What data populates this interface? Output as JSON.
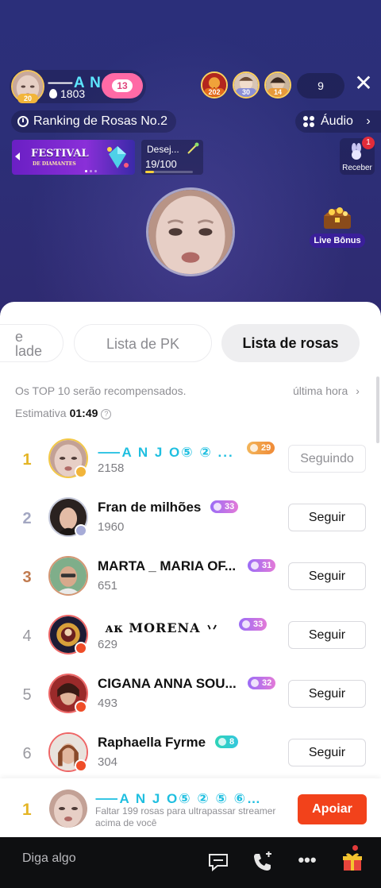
{
  "room": {
    "host_name_prefix": "⸺",
    "host_name_accent": "A N",
    "host_name_suffix": "...",
    "host_level": "20",
    "host_score": "1803",
    "follow_count": "13",
    "viewers": [
      {
        "level": "202",
        "color": "#e36a1c"
      },
      {
        "level": "30",
        "color": "#8a8fd6"
      },
      {
        "level": "14",
        "color": "#e89a3a"
      }
    ],
    "viewer_count": "9",
    "close_icon": "close-icon",
    "ranking_label": "Ranking de Rosas No.2",
    "audio_label": "Áudio",
    "festival_title": "FESTIVAL",
    "festival_subtitle": "DE DIAMANTES",
    "wish_label": "Desej...",
    "wish_progress": "19/100",
    "wish_fraction": 0.19,
    "receive_label": "Receber",
    "receive_badge": "1",
    "live_bonus_label": "Live Bônus"
  },
  "sheet": {
    "tabs": [
      {
        "label": "e\nlade"
      },
      {
        "label": "Lista de PK"
      },
      {
        "label": "Lista de rosas"
      }
    ],
    "note": "Os TOP 10 serão recompensados.",
    "last_hour": "última hora",
    "estimate_label": "Estimativa",
    "estimate_time": "01:49",
    "rows": [
      {
        "rank": "1",
        "name": "⸺A N J O⑤ ② ...",
        "level": "29",
        "level_style": "orange",
        "score": "2158",
        "action": "Seguindo"
      },
      {
        "rank": "2",
        "name": "Fran de milhões",
        "level": "33",
        "level_style": "purple",
        "score": "1960",
        "action": "Seguir"
      },
      {
        "rank": "3",
        "name": "MARTA _ MARIA OF...",
        "level": "31",
        "level_style": "purple",
        "score": "651",
        "action": "Seguir"
      },
      {
        "rank": "4",
        "name": "ᴀᴋ   MORENA   丷",
        "level": "33",
        "level_style": "purple",
        "score": "629",
        "action": "Seguir"
      },
      {
        "rank": "5",
        "name": "CIGANA ANNA SOU...",
        "level": "32",
        "level_style": "purple",
        "score": "493",
        "action": "Seguir"
      },
      {
        "rank": "6",
        "name": "Raphaella Fyrme",
        "level": "8",
        "level_style": "teal",
        "score": "304",
        "action": "Seguir"
      }
    ]
  },
  "my_rank": {
    "rank": "1",
    "name": "⸺A N J O⑤ ② ⑤ ⑥⸺🙏...",
    "hint": "Faltar 199 rosas para ultrapassar streamer acima de você",
    "support_label": "Apoiar"
  },
  "bottom": {
    "say_placeholder": "Diga algo"
  }
}
